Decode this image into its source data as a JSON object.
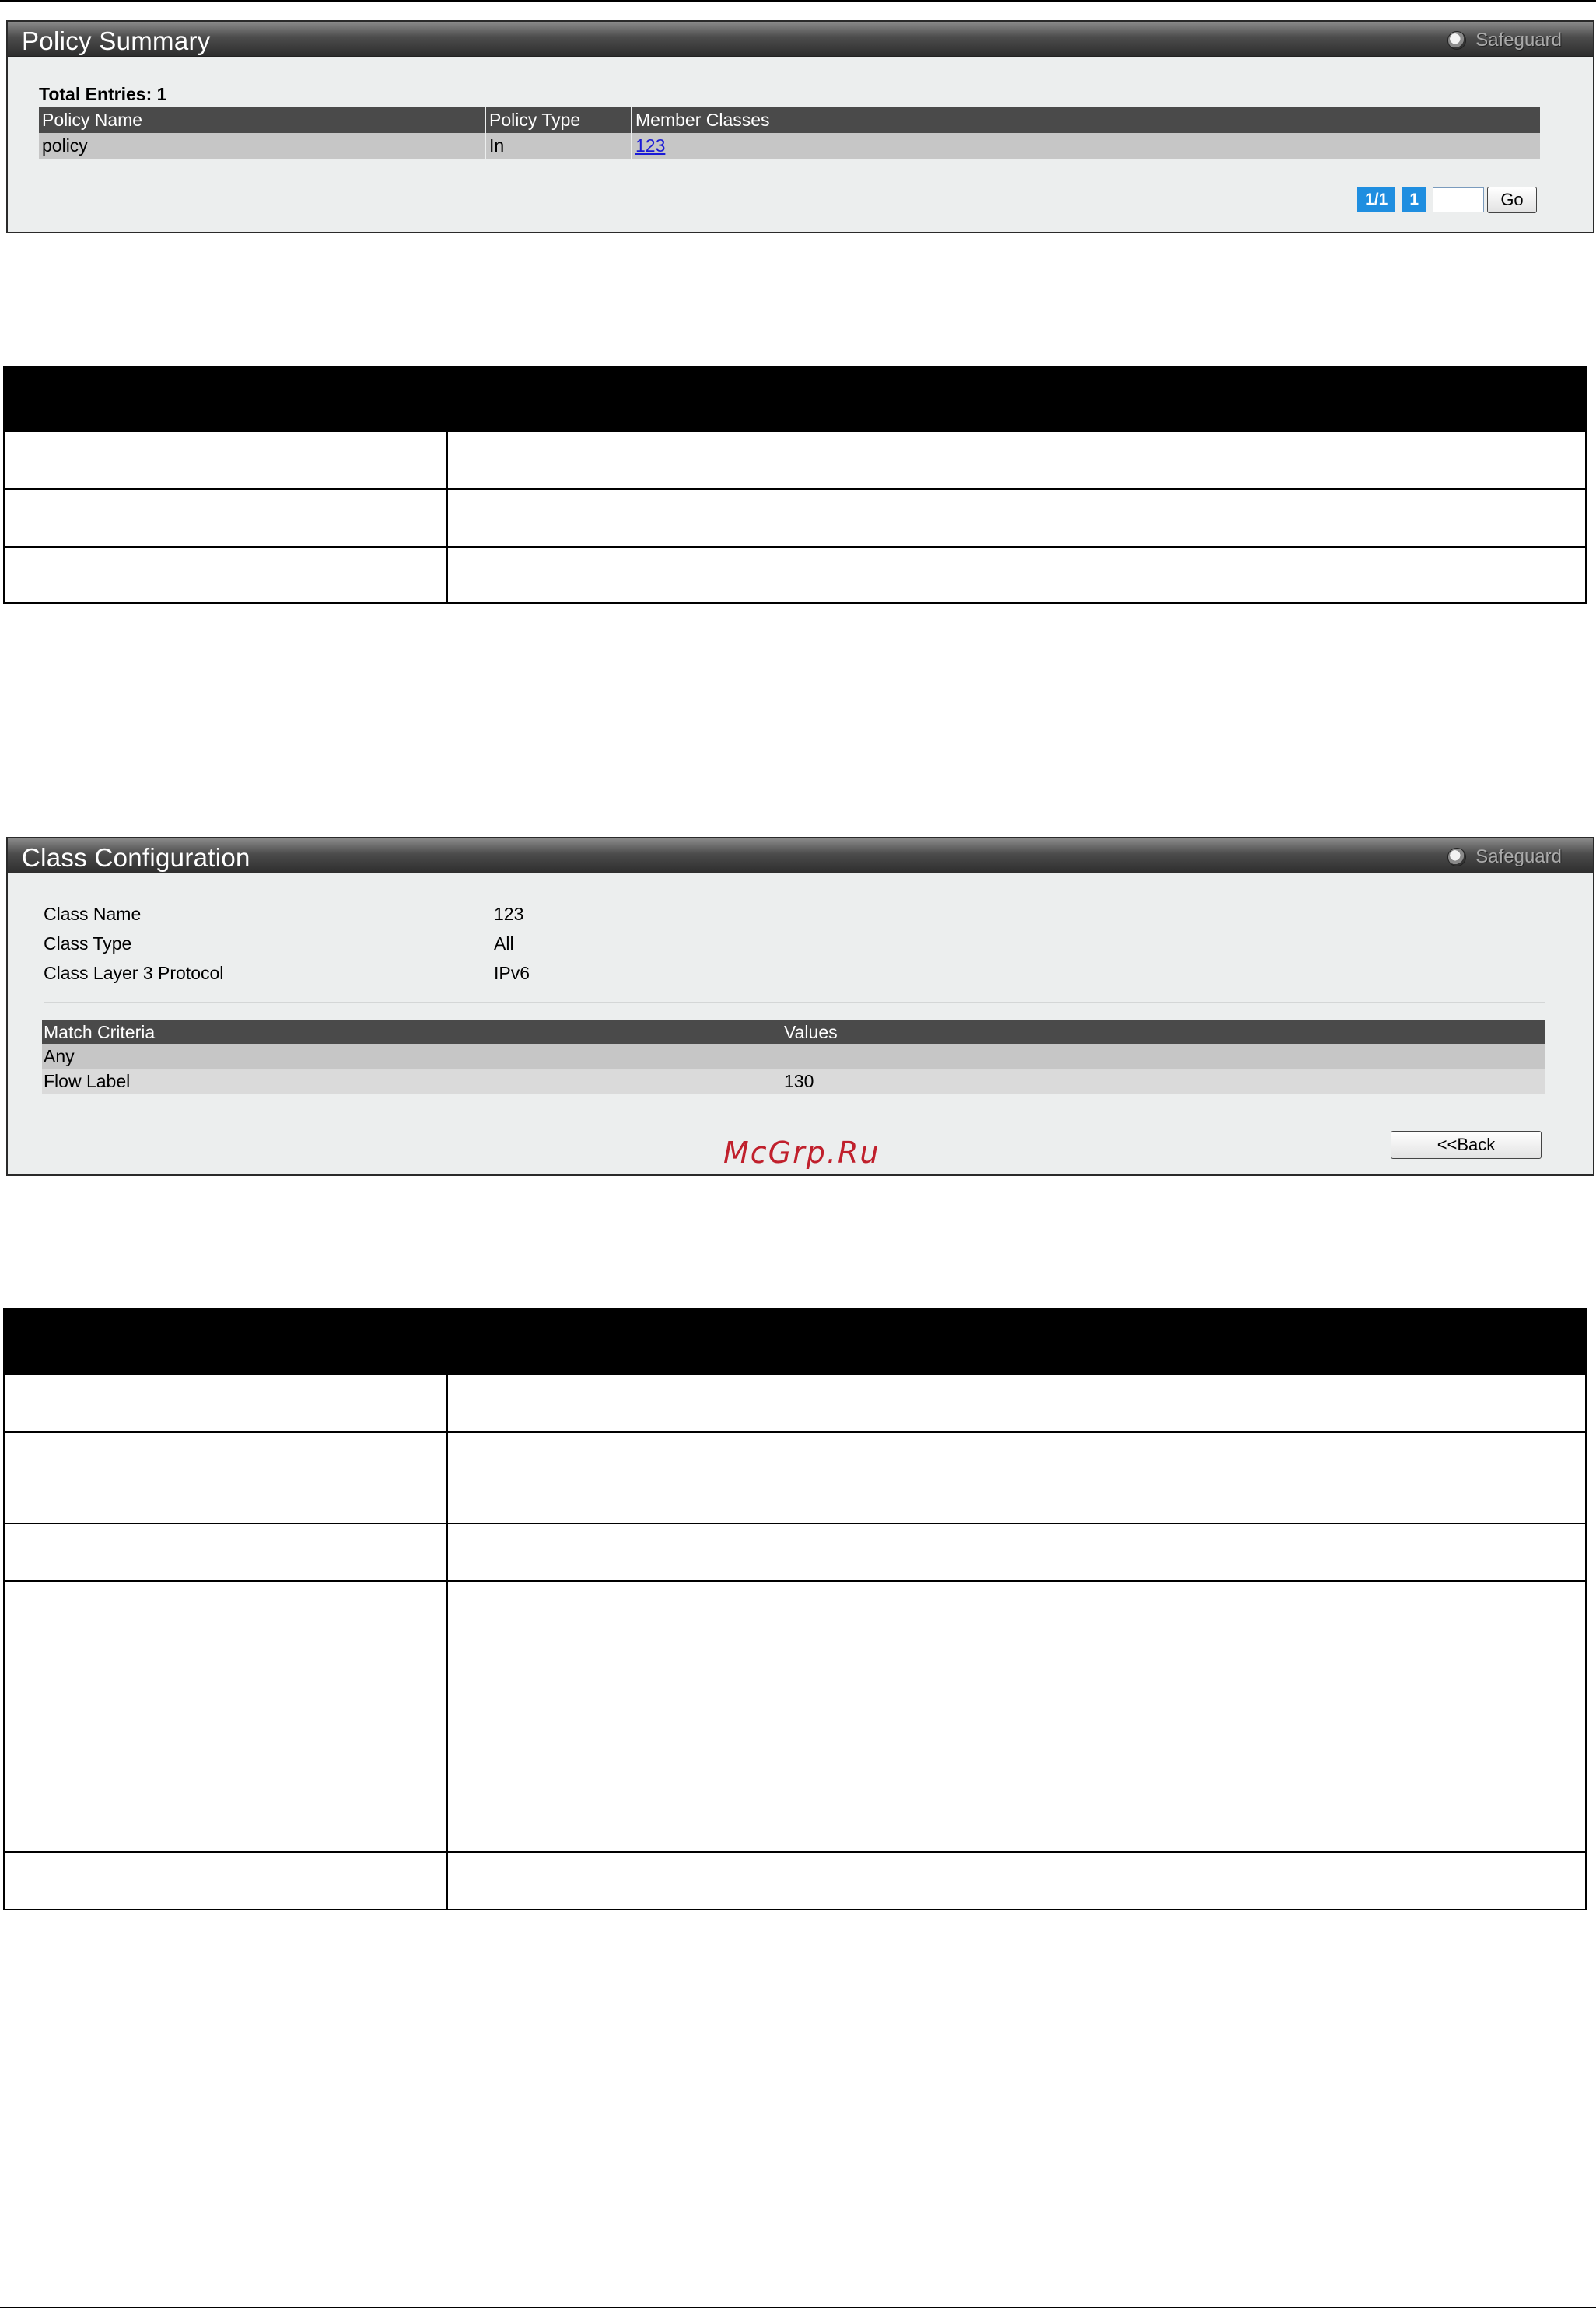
{
  "policy_summary": {
    "title": "Policy Summary",
    "safeguard": "Safeguard",
    "total_entries": "Total Entries: 1",
    "columns": [
      "Policy Name",
      "Policy Type",
      "Member Classes"
    ],
    "rows": [
      {
        "name": "policy",
        "type": "In",
        "classes": "123"
      }
    ],
    "pager": {
      "page_info": "1/1",
      "page": "1",
      "go_label": "Go",
      "input_value": ""
    }
  },
  "class_configuration": {
    "title": "Class Configuration",
    "safeguard": "Safeguard",
    "fields": [
      {
        "label": "Class Name",
        "value": "123"
      },
      {
        "label": "Class Type",
        "value": "All"
      },
      {
        "label": "Class Layer 3 Protocol",
        "value": "IPv6"
      }
    ],
    "columns": [
      "Match Criteria",
      "Values"
    ],
    "rows": [
      {
        "criteria": "Any",
        "value": ""
      },
      {
        "criteria": "Flow Label",
        "value": "130"
      }
    ],
    "back_label": "<<Back"
  },
  "watermark": "McGrp.Ru"
}
